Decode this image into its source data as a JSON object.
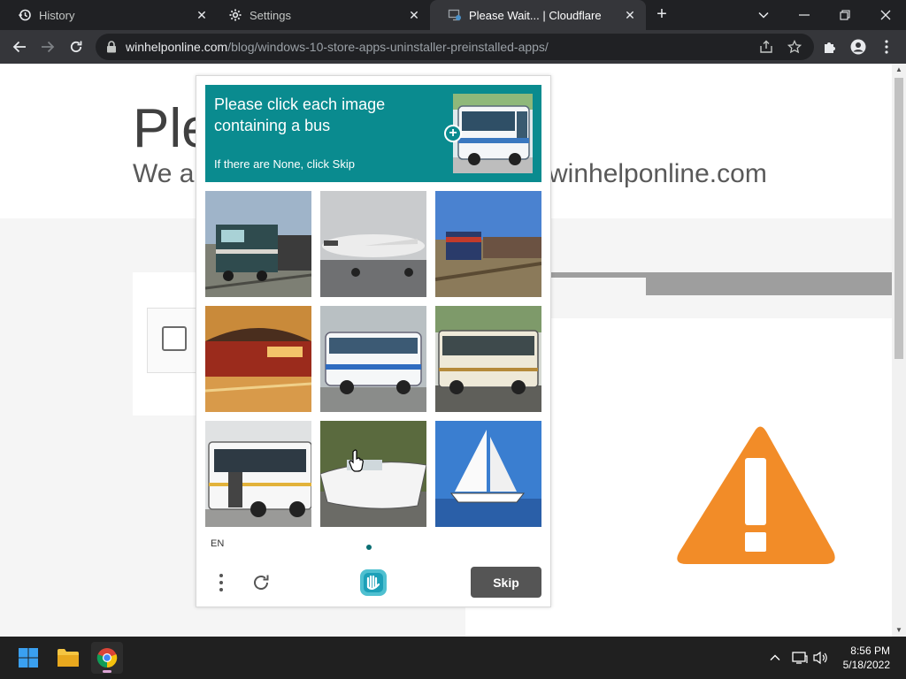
{
  "browser": {
    "tabs": [
      {
        "title": "History",
        "icon": "history-icon",
        "active": false
      },
      {
        "title": "Settings",
        "icon": "gear-icon",
        "active": false
      },
      {
        "title": "Please Wait... | Cloudflare",
        "icon": "cloudflare-loading-icon",
        "active": true
      }
    ],
    "url_host": "winhelponline.com",
    "url_path": "/blog/windows-10-store-apps-uninstaller-preinstalled-apps/"
  },
  "page": {
    "heading_partial": "Ple",
    "sub_partial": "We ar",
    "sub_right": "winhelponline.com"
  },
  "captcha": {
    "prompt": "Please click each image containing a bus",
    "hint": "If there are None, click Skip",
    "example_label": "bus",
    "tiles": [
      {
        "subject": "train"
      },
      {
        "subject": "airplane"
      },
      {
        "subject": "freight train"
      },
      {
        "subject": "subway train"
      },
      {
        "subject": "bus"
      },
      {
        "subject": "bus"
      },
      {
        "subject": "bus"
      },
      {
        "subject": "motorboat"
      },
      {
        "subject": "sailboat"
      }
    ],
    "language": "EN",
    "skip_label": "Skip"
  },
  "taskbar": {
    "time": "8:56 PM",
    "date": "5/18/2022"
  },
  "colors": {
    "captcha_accent": "#0a8b8f",
    "warning_orange": "#f28c28",
    "skip_button": "#555555"
  }
}
